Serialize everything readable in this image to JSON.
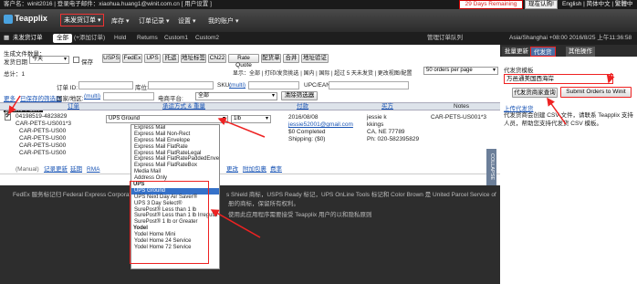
{
  "infobar": {
    "account": "客户名：winit2016 | 登录电子邮件：xiaohua.huang1@winit.com.cn [ 用户设置 ]",
    "trial": "29 Days Remaining",
    "buy": "现在认购!",
    "lang": "English | 简体中文 | 繁體中文 | 退出"
  },
  "nav": {
    "logo": "Teapplix",
    "unshipped": "未发货订单 ▾",
    "inventory": "库存 ▾",
    "orders": "订单记录 ▾",
    "settings": "设置 ▾",
    "account": "我的账户 ▾"
  },
  "subbar": {
    "title": "未发货订单",
    "all": "全部",
    "add": "(+添加订单)",
    "hold": "Hold",
    "returns": "Returns",
    "custom1": "Custom1",
    "custom2": "Custom2",
    "queue": "管理订单队列",
    "clock": "Asia/Shanghai +08:00 2016/8/25 上午11:36:58"
  },
  "filters": {
    "gen_label": "生成文件数量：",
    "ship_date_label": "发货日期",
    "ship_date": "今天",
    "save": "保存",
    "total": "总计：1",
    "per_page": "50 orders per page",
    "display_label": "显示：全部 | 打印/发货挑选 | 国内 | 国际 | 超过 5 天未发货 | 更改视图/配置",
    "order_id_label": "订单 ID:",
    "warehouse_label": "库位:",
    "sku_label": "SKU:",
    "sku_link": "(multi)",
    "upc_label": "UPC/EAN:",
    "more": "更多",
    "batch_label": "已保存的筛选器",
    "country_label": "国家/地区:",
    "country_link": "(multi)",
    "platform_label": "电商平台:",
    "platform": "全部",
    "clear": "清除筛选器",
    "batch_ops": "批量订单操作"
  },
  "ship_buttons": [
    "USPS",
    "FedEx",
    "UPS",
    "托运",
    "地址标签",
    "CN22",
    "Rate Quote",
    "配货单",
    "合并",
    "地址验证"
  ],
  "table": {
    "col_order": "订单",
    "col_ship": "承运方式 & 重量",
    "col_pay": "付款",
    "col_buyer": "买方",
    "col_notes": "Notes"
  },
  "order": {
    "id": "04198519-4823829",
    "skus": [
      "CAR-PETS-US001*3",
      "CAR-PETS-US00",
      "CAR-PETS-US00",
      "CAR-PETS-US00",
      "CAR-PETS-US00"
    ],
    "manual": "(Manual)",
    "method": "UPS Ground",
    "weight": "1lb",
    "date": "2016/08/08",
    "email": "jessie52001@gmail.com",
    "status": "$0 Completed",
    "shipping": "Shipping: ($0)",
    "buyer": [
      "jessie k",
      "kkings",
      "CA, NE 77789",
      "Ph: 020-582395829"
    ],
    "note": "CAR-PETS-US001*3",
    "footer_links": [
      "记录更新",
      "延期",
      "RMA"
    ],
    "footer_links2": [
      "更改",
      "附加包裹",
      "费率"
    ]
  },
  "dropdown": {
    "options_top": [
      "Express Mail",
      "Express Mail Non-Rect",
      "Express Mail Envelope",
      "Express Mail FlatRate",
      "Express Mail FlatRateLegal",
      "Express Mail FlatRatePaddedEnvelope",
      "Express Mail FlatRateBox",
      "Media Mail",
      "Address Only"
    ],
    "group_ups": "UPS",
    "options_ups": [
      "UPS Ground",
      "UPS Next Day Air Saver®",
      "UPS 3 Day Select®",
      "SurePost® Less than 1 lb",
      "SurePost® Less than 1 lb Irregular",
      "SurePost® 1 lb or Greater"
    ],
    "group_yodel": "Yodel",
    "options_yodel": [
      "Yodel Home Mini",
      "Yodel Home 24 Service",
      "Yodel Home 72 Service"
    ]
  },
  "footer": {
    "text1": "FedEx 服务标记归 Federal Express Corporation 所有。",
    "text2": "s Shield 商标，USPS Ready 标记，UPS OnLine Tools 标记和 Color Brown 是 United Parcel Service of",
    "text3": "册的商标，保留所有权利。",
    "text4": "使用此应用程序需要接受 Teapplix 用户的以和隐私原则",
    "copyright": "©",
    "collapse": "COLLAPSE"
  },
  "rightpanel": {
    "tab_batch": "批量更新",
    "tab_ship": "代发货",
    "tab_other": "其他操作",
    "template_label": "代发货模板",
    "template": "万邑通美国西海岸",
    "btn_query": "代发货商家查询",
    "btn_submit": "Submit Orders to Winit",
    "upload": "上传代发货",
    "desc": "代发货商会创建 CSV 文件，请联系 Teapplix 支持人员，帮助您支持代发货 CSV 模板。"
  }
}
